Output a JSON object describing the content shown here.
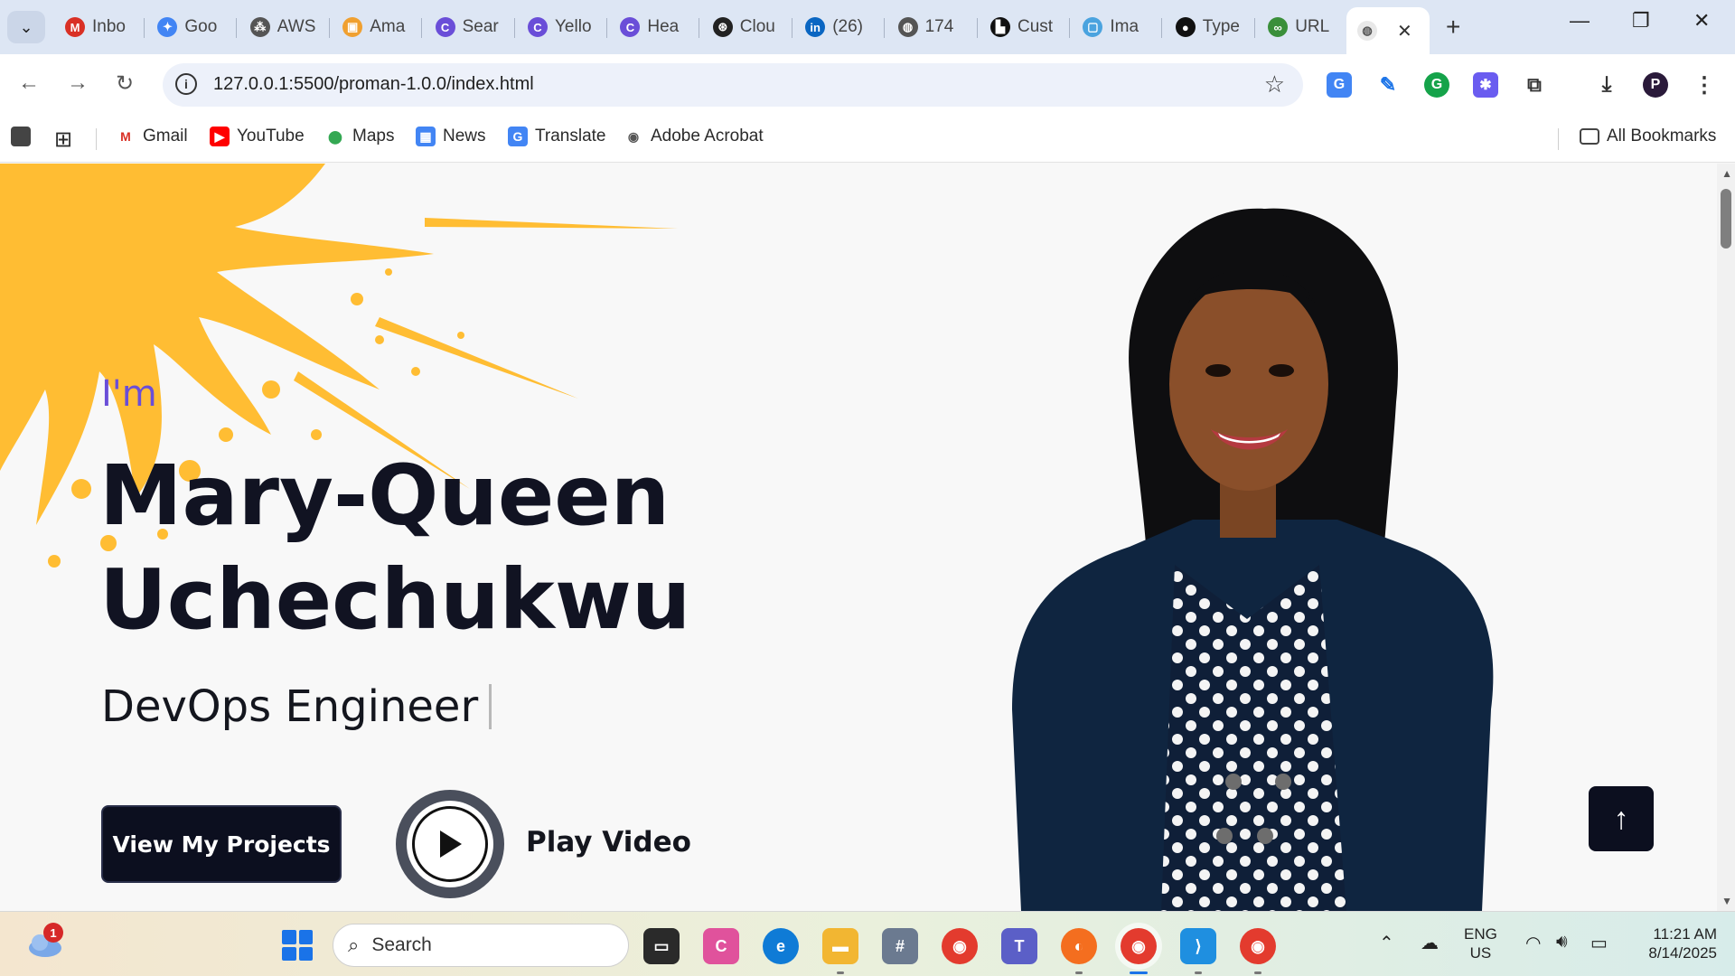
{
  "browser": {
    "tabs": [
      {
        "label": "Inbo",
        "icon": "gmail-icon",
        "color": "#d93025"
      },
      {
        "label": "Goo",
        "icon": "gemini-icon",
        "color": "#4285f4"
      },
      {
        "label": "AWS",
        "icon": "aws-icon",
        "color": "#555555"
      },
      {
        "label": "Ama",
        "icon": "amazon-icon",
        "color": "#f0a030"
      },
      {
        "label": "Sear",
        "icon": "canva-icon",
        "color": "#6a4ed8"
      },
      {
        "label": "Yello",
        "icon": "canva-icon",
        "color": "#6a4ed8"
      },
      {
        "label": "Hea",
        "icon": "canva-icon",
        "color": "#6a4ed8"
      },
      {
        "label": "Clou",
        "icon": "openai-icon",
        "color": "#222222"
      },
      {
        "label": "(26)",
        "icon": "linkedin-icon",
        "color": "#0a66c2"
      },
      {
        "label": "174",
        "icon": "globe-icon",
        "color": "#555555"
      },
      {
        "label": "Cust",
        "icon": "unsplash-icon",
        "color": "#111111"
      },
      {
        "label": "Ima",
        "icon": "image-icon",
        "color": "#4aa3df"
      },
      {
        "label": "Type",
        "icon": "medium-icon",
        "color": "#111111"
      },
      {
        "label": "URL",
        "icon": "link-icon",
        "color": "#3a8f3a"
      }
    ],
    "active_tab_icon": "globe-icon",
    "url": "127.0.0.1:5500/proman-1.0.0/index.html"
  },
  "bookmarks": {
    "items": [
      {
        "label": "Gmail",
        "icon": "gmail-icon"
      },
      {
        "label": "YouTube",
        "icon": "youtube-icon"
      },
      {
        "label": "Maps",
        "icon": "maps-icon"
      },
      {
        "label": "News",
        "icon": "news-icon"
      },
      {
        "label": "Translate",
        "icon": "translate-icon"
      },
      {
        "label": "Adobe Acrobat",
        "icon": "acrobat-icon"
      }
    ],
    "all_bookmarks": "All Bookmarks"
  },
  "hero": {
    "intro": "I'm",
    "name_line1": "Mary-Queen",
    "name_line2": "Uchechukwu",
    "role": "DevOps Engineer",
    "projects_button": "View My Projects",
    "play_label": "Play Video",
    "accent_color": "#6a4ed8",
    "splash_color": "#ffbd33"
  },
  "taskbar": {
    "weather_badge": "1",
    "search_placeholder": "Search",
    "lang_line1": "ENG",
    "lang_line2": "US",
    "time": "11:21 AM",
    "date": "8/14/2025"
  }
}
